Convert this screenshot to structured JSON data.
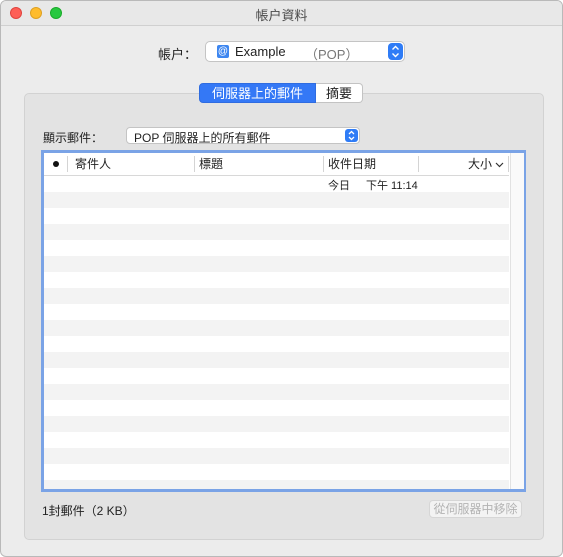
{
  "window": {
    "title": "帳户資料"
  },
  "account": {
    "label": "帳户：",
    "icon": "at-sign-icon",
    "name": "Example",
    "type": "（POP）"
  },
  "tabs": [
    {
      "label": "伺服器上的郵件",
      "active": true
    },
    {
      "label": "摘要",
      "active": false
    }
  ],
  "filter": {
    "label": "顯示郵件：",
    "value": "POP 伺服器上的所有郵件"
  },
  "table": {
    "columns": {
      "read": "●",
      "sender": "寄件人",
      "subject": "標題",
      "date": "收件日期",
      "size": "大小"
    },
    "rows": [
      {
        "sender": "",
        "subject": "",
        "date": "今日",
        "time": "下午 11:14",
        "size": ""
      }
    ]
  },
  "footer": {
    "count": "1封郵件（2 KB）",
    "remove_button": "從伺服器中移除"
  },
  "colors": {
    "accent": "#3478f6",
    "close": "#fe5f57",
    "minimize": "#febc2e",
    "maximize": "#28c840"
  }
}
